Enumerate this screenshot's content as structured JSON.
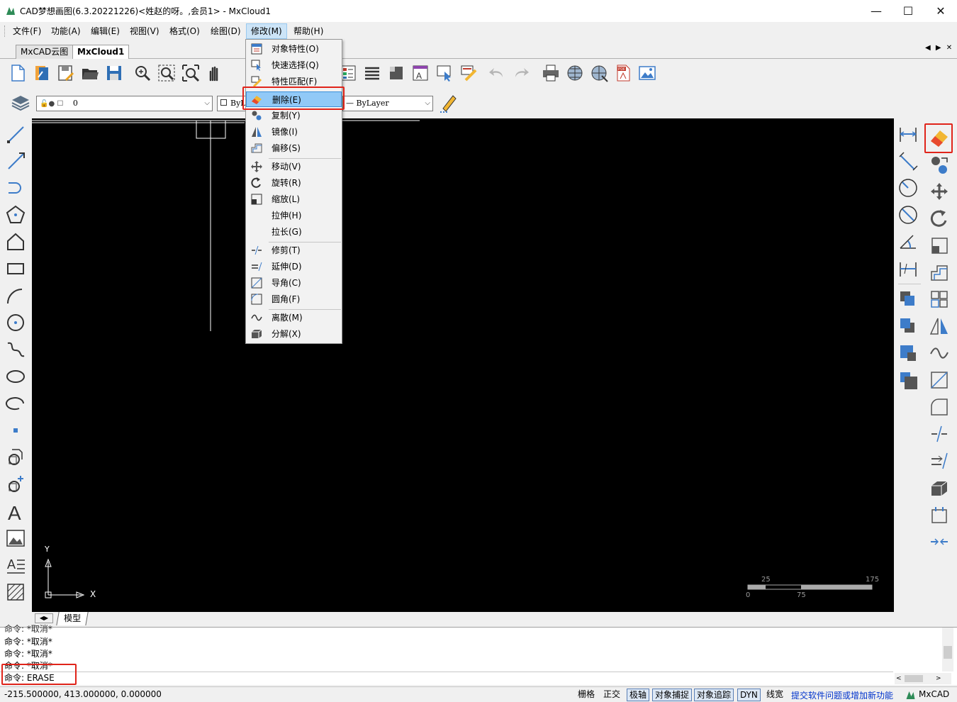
{
  "window": {
    "title": "CAD梦想画图(6.3.20221226)<姓赵的呀。,会员1> - MxCloud1",
    "minimize": "—",
    "maximize": "☐",
    "close": "✕"
  },
  "menubar": {
    "items": [
      "文件(F)",
      "功能(A)",
      "编辑(E)",
      "视图(V)",
      "格式(O)",
      "绘图(D)",
      "修改(M)",
      "帮助(H)"
    ]
  },
  "tabs": {
    "items": [
      "MxCAD云图",
      "MxCloud1"
    ],
    "nav": "◀ ▶ ✕"
  },
  "layer_toolbar": {
    "layer_value": "0",
    "color_value": "ByL",
    "linetype_value": "ByLayer"
  },
  "modify_menu": {
    "items": [
      {
        "label": "对象特性(O)"
      },
      {
        "label": "快速选择(Q)"
      },
      {
        "label": "特性匹配(F)"
      },
      {
        "label": "删除(E)"
      },
      {
        "label": "复制(Y)"
      },
      {
        "label": "镜像(I)"
      },
      {
        "label": "偏移(S)"
      },
      {
        "label": "移动(V)"
      },
      {
        "label": "旋转(R)"
      },
      {
        "label": "缩放(L)"
      },
      {
        "label": "拉伸(H)"
      },
      {
        "label": "拉长(G)"
      },
      {
        "label": "修剪(T)"
      },
      {
        "label": "延伸(D)"
      },
      {
        "label": "导角(C)"
      },
      {
        "label": "圆角(F)"
      },
      {
        "label": "离散(M)"
      },
      {
        "label": "分解(X)"
      }
    ],
    "highlighted": "删除(E)"
  },
  "canvas": {
    "ucs_x": "X",
    "ucs_y": "Y",
    "scale_labels": {
      "l25": "25",
      "l175": "175",
      "l0": "0",
      "l75": "75"
    }
  },
  "layout_tabs": {
    "model": "模型"
  },
  "command_history": [
    "命令:  *取消*",
    "命令:  *取消*",
    "命令:  *取消*",
    "命令:  *取消*",
    "命令: ERASE"
  ],
  "statusbar": {
    "coords": "-215.500000,  413.000000,  0.000000",
    "toggles": [
      "栅格",
      "正交",
      "极轴",
      "对象捕捉",
      "对象追踪",
      "DYN",
      "线宽"
    ],
    "toggles_on": [
      "极轴",
      "对象捕捉",
      "对象追踪",
      "DYN"
    ],
    "feedback_link": "提交软件问题或增加新功能",
    "brand": "MxCAD"
  },
  "colors": {
    "highlight": "#91c9f7",
    "annotation_red": "#e0241a",
    "link_blue": "#0033cc",
    "canvas": "#000000"
  }
}
